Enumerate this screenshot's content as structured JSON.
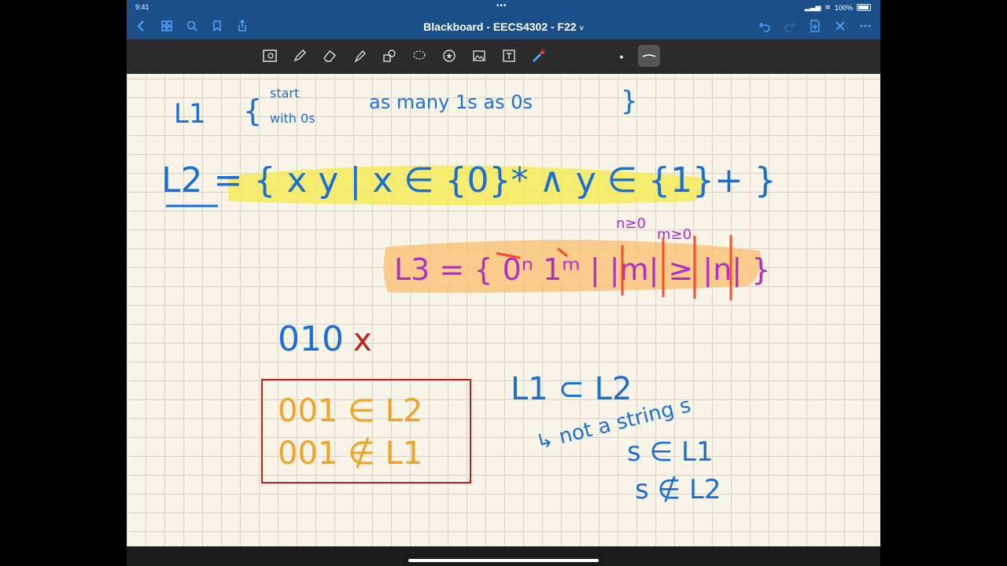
{
  "status_bar": {
    "time": "9:41",
    "battery": "100%"
  },
  "nav": {
    "title": "Blackboard - EECS4302 - F22",
    "title_chevron": "˅"
  },
  "toolbar": {
    "tools": [
      "scan-tool",
      "pen-tool",
      "eraser-tool",
      "highlighter-tool",
      "shapes-tool",
      "lasso-tool",
      "sticker-tool",
      "image-tool",
      "text-tool",
      "laser-pointer-tool"
    ],
    "selected_tool": "laser-pointer-tool",
    "dot_size": "•"
  },
  "notes": {
    "l1_label": "L1",
    "l1_start": "start",
    "l1_with": "with 0s",
    "l1_rest": "as many 1s as 0s",
    "l2_def": "L2 = { x y | x ∈ {0}* ∧ y ∈ {1}+ }",
    "l3_cond_n": "n≥0",
    "l3_cond_m": "m≥0",
    "l3_def": "L3 = { 0ⁿ 1ᵐ | |m| ≥ |n| }",
    "try_string": "010",
    "try_mark": "x",
    "box_line1": "001 ∈ L2",
    "box_line2": "001 ∉ L1",
    "subset": "L1 ⊂ L2",
    "arrow_note": "↳ not a string s",
    "s_in": "s ∈ L1",
    "s_notin": "s ∉ L2"
  },
  "colors": {
    "nav_bg": "#1b4f8a",
    "ink_blue": "#1a6fd4",
    "ink_purple": "#b02ec8",
    "ink_orange": "#f0a325",
    "ink_red": "#c0201c",
    "highlight_yellow": "#f5ea5a",
    "highlight_orange": "#f9c47a",
    "laser_red": "#ff3b1f"
  }
}
